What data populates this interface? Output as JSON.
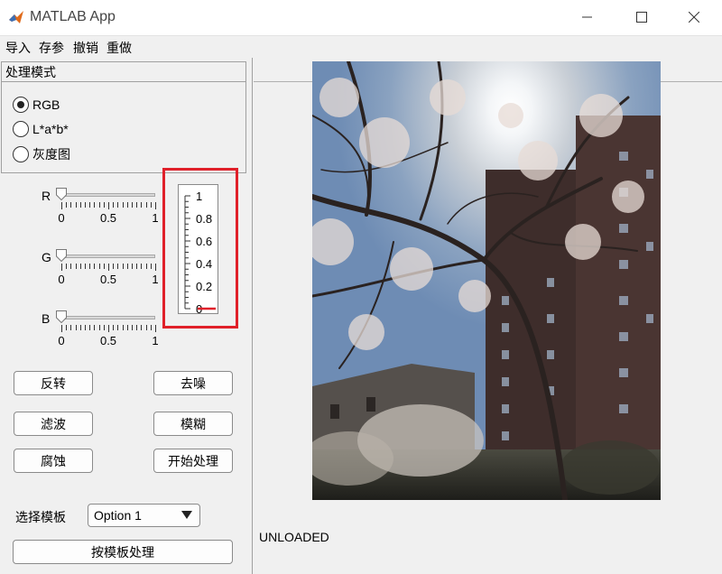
{
  "window": {
    "title": "MATLAB App"
  },
  "menu": [
    "导入",
    "存参",
    "撤销",
    "重做"
  ],
  "mode_group": {
    "title": "处理模式",
    "options": [
      {
        "label": "RGB",
        "checked": true
      },
      {
        "label": "L*a*b*",
        "checked": false
      },
      {
        "label": "灰度图",
        "checked": false
      }
    ]
  },
  "sliders": [
    {
      "label": "R",
      "value": 0,
      "ticks": [
        "0",
        "0.5",
        "1"
      ]
    },
    {
      "label": "G",
      "value": 0,
      "ticks": [
        "0",
        "0.5",
        "1"
      ]
    },
    {
      "label": "B",
      "value": 0,
      "ticks": [
        "0",
        "0.5",
        "1"
      ]
    }
  ],
  "gauge": {
    "value": 0,
    "ticks": [
      "1",
      "0.8",
      "0.6",
      "0.4",
      "0.2",
      "0"
    ],
    "needle_color": "#e0202a"
  },
  "buttons": {
    "invert": "反转",
    "denoise": "去噪",
    "filter": "滤波",
    "blur": "模糊",
    "erode": "腐蚀",
    "start": "开始处理",
    "template_process": "按模板处理"
  },
  "template": {
    "label": "选择模板",
    "selected": "Option 1"
  },
  "status": "UNLOADED",
  "colors": {
    "highlight": "#e0202a",
    "sky": "#8ea9c9",
    "building": "#3a2c2a"
  }
}
